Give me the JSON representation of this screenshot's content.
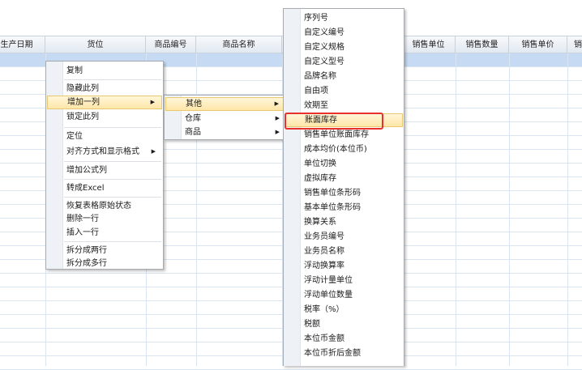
{
  "columns": [
    "生产日期",
    "货位",
    "商品编号",
    "商品名称",
    "",
    "销售单位",
    "销售数量",
    "销售单价",
    "销"
  ],
  "context_menu": {
    "items": [
      "复制",
      "隐藏此列",
      "增加一列",
      "锁定此列",
      "定位",
      "对齐方式和显示格式",
      "增加公式列",
      "转成Excel",
      "恢复表格原始状态",
      "删除一行",
      "插入一行",
      "拆分成两行",
      "拆分成多行"
    ],
    "submenu_arrow": "▶"
  },
  "add_column_submenu": {
    "items": [
      "其他",
      "仓库",
      "商品"
    ]
  },
  "other_submenu": {
    "items": [
      "序列号",
      "自定义编号",
      "自定义规格",
      "自定义型号",
      "品牌名称",
      "自由项",
      "效期至",
      "账面库存",
      "销售单位账面库存",
      "成本均价(本位币)",
      "单位切换",
      "虚拟库存",
      "销售单位条形码",
      "基本单位条形码",
      "换算关系",
      "业务员编号",
      "业务员名称",
      "浮动换算率",
      "浮动计量单位",
      "浮动单位数量",
      "税率（%）",
      "税额",
      "本位币金额",
      "本位币折后金额"
    ]
  }
}
